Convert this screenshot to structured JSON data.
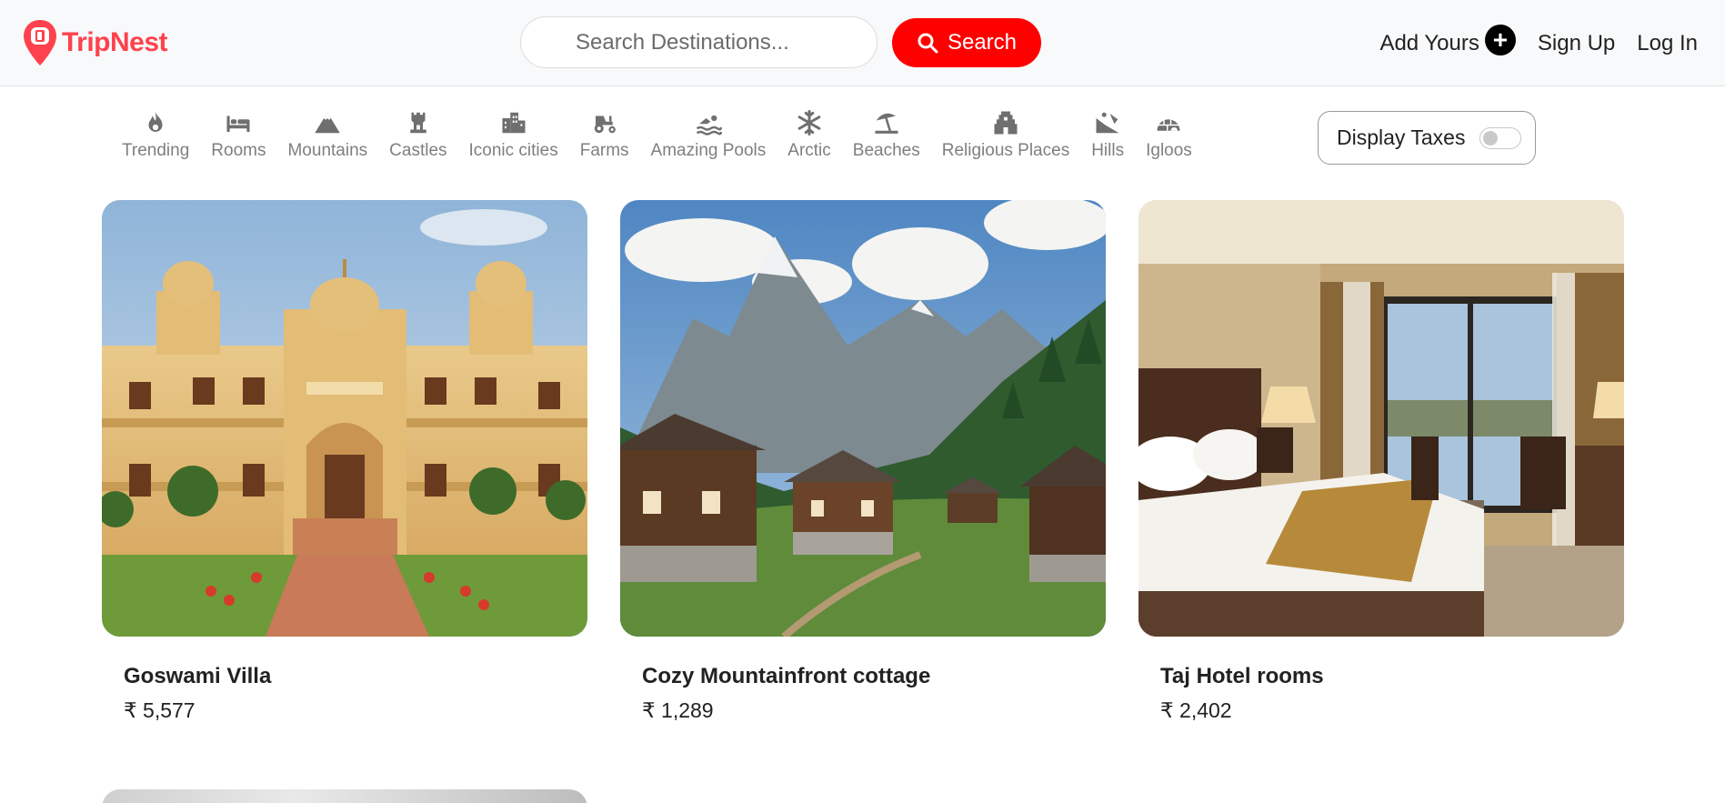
{
  "navbar": {
    "brand": "TripNest",
    "brand_color": "#fe424d",
    "search_placeholder": "Search Destinations...",
    "search_button": "Search",
    "add_yours": "Add Yours",
    "sign_up": "Sign Up",
    "log_in": "Log In"
  },
  "filters": [
    {
      "label": "Trending",
      "icon": "fire-icon"
    },
    {
      "label": "Rooms",
      "icon": "bed-icon"
    },
    {
      "label": "Mountains",
      "icon": "mountain-icon"
    },
    {
      "label": "Castles",
      "icon": "castle-icon"
    },
    {
      "label": "Iconic cities",
      "icon": "city-icon"
    },
    {
      "label": "Farms",
      "icon": "tractor-icon"
    },
    {
      "label": "Amazing Pools",
      "icon": "swimmer-icon"
    },
    {
      "label": "Arctic",
      "icon": "snowflake-icon"
    },
    {
      "label": "Beaches",
      "icon": "umbrella-beach-icon"
    },
    {
      "label": "Religious Places",
      "icon": "gopuram-icon"
    },
    {
      "label": "Hills",
      "icon": "hill-icon"
    },
    {
      "label": "Igloos",
      "icon": "igloo-icon"
    }
  ],
  "tax_toggle": {
    "label": "Display Taxes",
    "enabled": false
  },
  "listings": [
    {
      "title": "Goswami Villa",
      "price": "₹ 5,577",
      "image": "palace-villa"
    },
    {
      "title": "Cozy Mountainfront cottage",
      "price": "₹ 1,289",
      "image": "mountain-cottages"
    },
    {
      "title": "Taj Hotel rooms",
      "price": "₹ 2,402",
      "image": "hotel-room"
    }
  ],
  "colors": {
    "accent": "#fe0000",
    "navbar_bg": "#f8f9fa"
  }
}
